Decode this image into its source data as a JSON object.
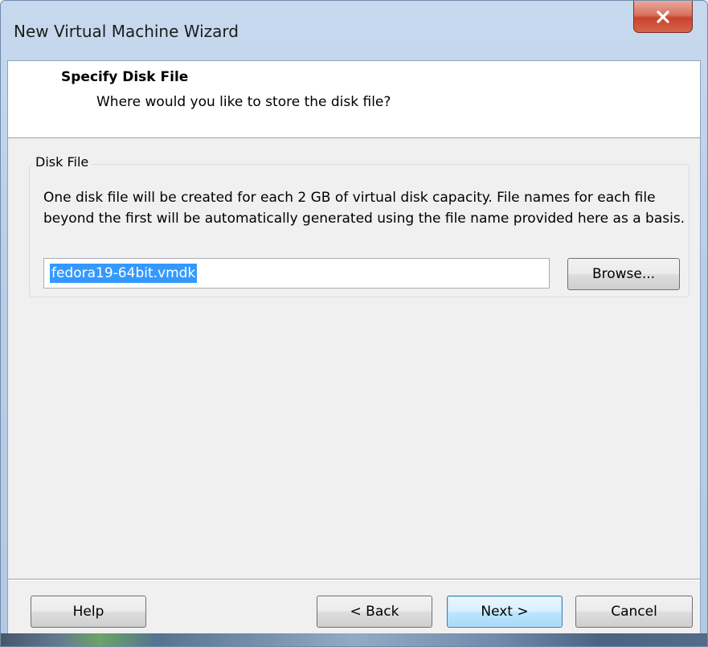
{
  "window": {
    "title": "New Virtual Machine Wizard"
  },
  "header": {
    "title": "Specify Disk File",
    "subtitle": "Where would you like to store the disk file?"
  },
  "disk_file_group": {
    "label": "Disk File",
    "description": "One disk file will be created for each 2 GB of virtual disk capacity. File names for each file beyond the first will be automatically generated using the file name provided here as a basis.",
    "file_name_value": "fedora19-64bit.vmdk",
    "browse_label": "Browse..."
  },
  "footer": {
    "help_label": "Help",
    "back_label": "< Back",
    "next_label": "Next >",
    "cancel_label": "Cancel"
  },
  "icons": {
    "close": "close-icon"
  },
  "colors": {
    "selection": "#3399ff",
    "close_button": "#c7442b",
    "default_button_border": "#3c7fb1"
  }
}
